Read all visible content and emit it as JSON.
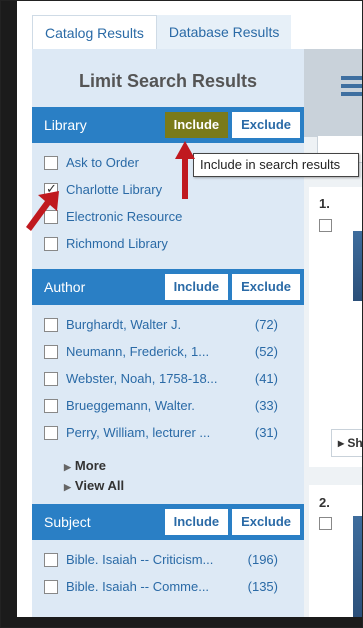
{
  "tabs": [
    {
      "label": "Catalog Results"
    },
    {
      "label": "Database Results"
    }
  ],
  "sidebar": {
    "title": "Limit Search Results",
    "include_label": "Include",
    "exclude_label": "Exclude",
    "facets": [
      {
        "name": "Library",
        "items": [
          {
            "label": "Ask to Order",
            "checked": false
          },
          {
            "label": "Charlotte Library",
            "checked": true
          },
          {
            "label": "Electronic Resource",
            "checked": false
          },
          {
            "label": "Richmond Library",
            "checked": false
          }
        ]
      },
      {
        "name": "Author",
        "items": [
          {
            "label": "Burghardt, Walter J.",
            "count": "(72)"
          },
          {
            "label": "Neumann, Frederick, 1...",
            "count": "(52)"
          },
          {
            "label": "Webster, Noah, 1758-18...",
            "count": "(41)"
          },
          {
            "label": "Brueggemann, Walter.",
            "count": "(33)"
          },
          {
            "label": "Perry, William, lecturer ...",
            "count": "(31)"
          }
        ],
        "more": "More",
        "view_all": "View All"
      },
      {
        "name": "Subject",
        "items": [
          {
            "label": "Bible. Isaiah -- Criticism...",
            "count": "(196)"
          },
          {
            "label": "Bible. Isaiah -- Comme...",
            "count": "(135)"
          }
        ]
      }
    ]
  },
  "tooltip": "Include in search results",
  "results": {
    "first_num": "1.",
    "second_num": "2.",
    "show_label": "Sh"
  },
  "colors": {
    "facet_header": "#2a7fc5",
    "sidebar_bg": "#dde9f5",
    "include_highlight": "#7a7a1a",
    "arrow": "#c0191f"
  }
}
